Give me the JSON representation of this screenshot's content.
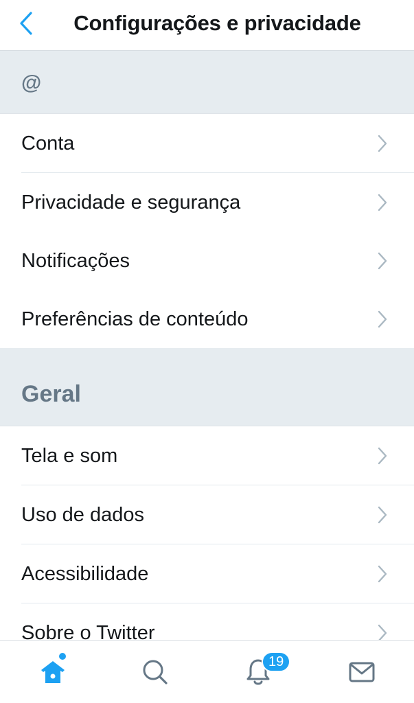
{
  "colors": {
    "accent": "#1da1f2",
    "section_bg": "#e6ecf0",
    "text_primary": "#14171a",
    "text_secondary": "#657786",
    "chevron": "#aab8c2"
  },
  "header": {
    "back_icon": "chevron-left-icon",
    "title": "Configurações e privacidade"
  },
  "sections": [
    {
      "title": "@",
      "items": [
        {
          "label": "Conta"
        },
        {
          "label": "Privacidade e segurança"
        },
        {
          "label": "Notificações"
        },
        {
          "label": "Preferências de conteúdo"
        }
      ]
    },
    {
      "title": "Geral",
      "items": [
        {
          "label": "Tela e som"
        },
        {
          "label": "Uso de dados"
        },
        {
          "label": "Acessibilidade"
        },
        {
          "label": "Sobre o Twitter"
        }
      ]
    }
  ],
  "tabbar": {
    "tabs": [
      {
        "icon": "home-icon",
        "active": true,
        "has_dot": true
      },
      {
        "icon": "search-icon",
        "active": false
      },
      {
        "icon": "bell-icon",
        "active": false,
        "badge": "19"
      },
      {
        "icon": "mail-icon",
        "active": false
      }
    ]
  }
}
